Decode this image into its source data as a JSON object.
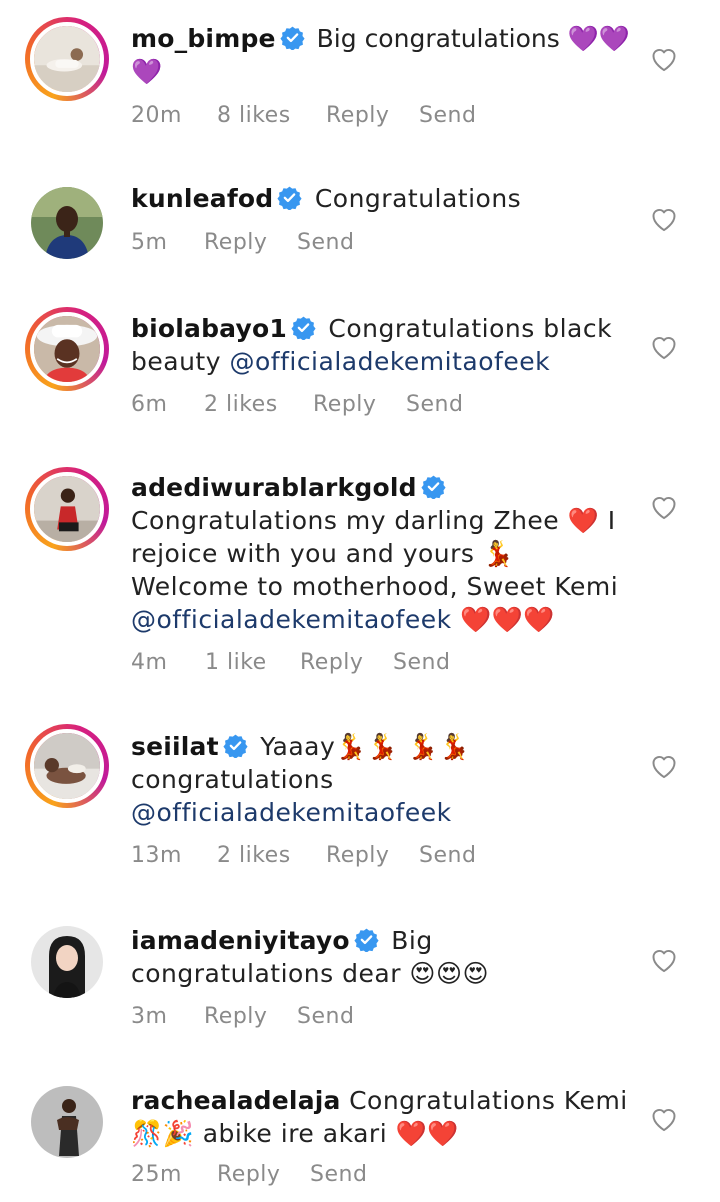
{
  "comments": [
    {
      "username": "mo_bimpe",
      "text": " Big congratulations 💜💜💜",
      "time": "20m",
      "likes": "8 likes",
      "reply": "Reply",
      "send": "Send"
    },
    {
      "username": "kunleafod",
      "text": " Congratulations",
      "time": "5m",
      "reply": "Reply",
      "send": "Send"
    },
    {
      "username": "biolabayo1",
      "text": " Congratulations black beauty ",
      "mention": "@officialadekemitaofeek",
      "time": "6m",
      "likes": "2 likes",
      "reply": "Reply",
      "send": "Send"
    },
    {
      "username": "adediwurablarkgold",
      "text": " Congratulations my darling Zhee ❤️ I rejoice with you and yours 💃 Welcome to motherhood, Sweet Kemi ",
      "mention": "@officialadekemitaofeek",
      "text_after": " ❤️❤️❤️",
      "time": "4m",
      "likes": "1 like",
      "reply": "Reply",
      "send": "Send"
    },
    {
      "username": "seiilat",
      "text": " Yaaay💃💃 💃💃 congratulations ",
      "mention": "@officialadekemitaofeek",
      "time": "13m",
      "likes": "2 likes",
      "reply": "Reply",
      "send": "Send"
    },
    {
      "username": "iamadeniyitayo",
      "text": " Big congratulations dear 😍😍😍",
      "time": "3m",
      "reply": "Reply",
      "send": "Send"
    },
    {
      "username": "rachealadelaja",
      "text": " Congratulations Kemi 🎊🎉 abike ire akari ❤️❤️",
      "time": "25m",
      "reply": "Reply",
      "send": "Send"
    }
  ],
  "colors": {
    "verified_badge": "#3897f0",
    "meta_text": "#8a8a8a",
    "mention": "#1d3a6b",
    "story_ring": [
      "#f9a31b",
      "#f1652b",
      "#d6207f",
      "#c01a9a"
    ]
  },
  "icons": {
    "verified": "verified-badge-icon",
    "like": "heart-outline-icon"
  }
}
